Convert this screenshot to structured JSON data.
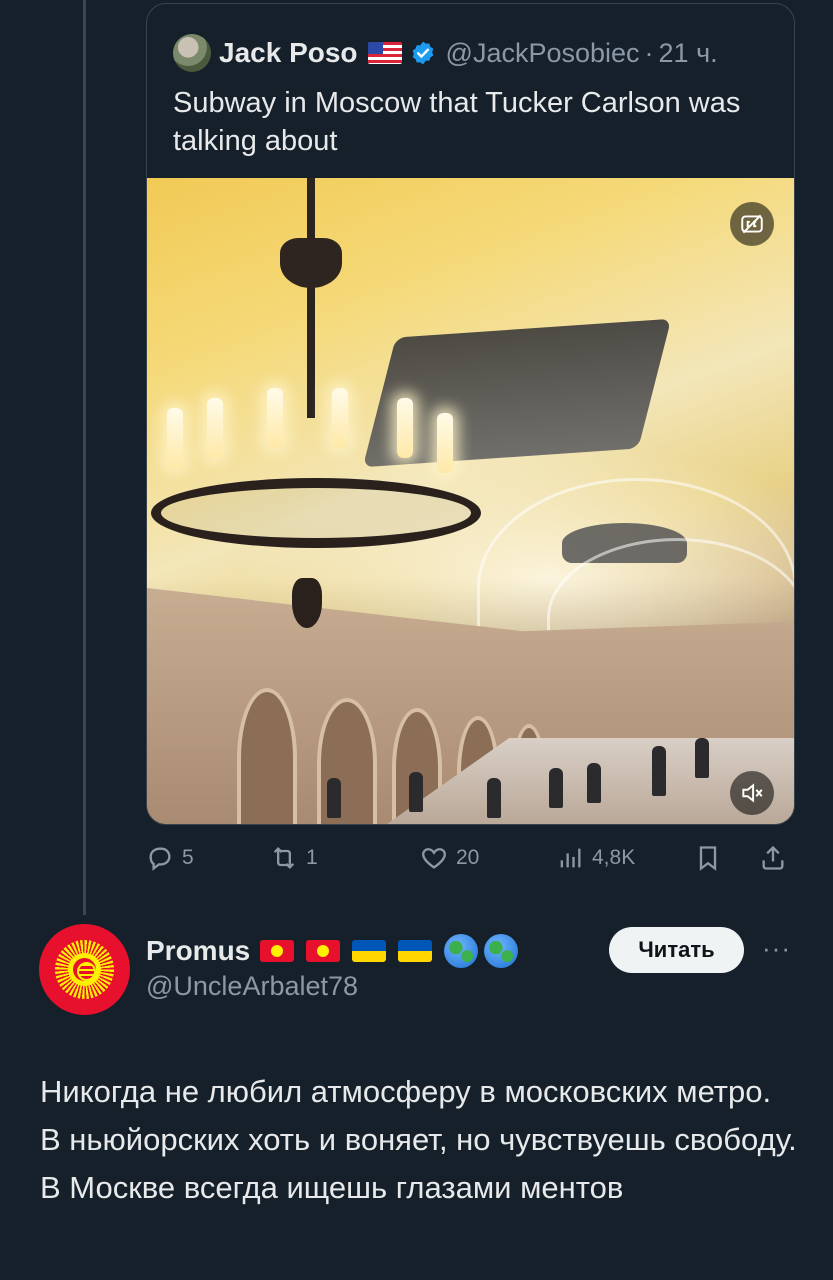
{
  "quoted_tweet": {
    "author_name": "Jack Poso",
    "handle": "@JackPosobiec",
    "separator": "·",
    "time": "21 ч.",
    "text": "Subway in Moscow that Tucker Carlson was talking about",
    "media": {
      "description": "Moscow metro station video",
      "cc_icon": "closed-captions-icon",
      "mute_icon": "volume-muted-icon"
    }
  },
  "actions": {
    "replies": "5",
    "reposts": "1",
    "likes": "20",
    "views": "4,8K"
  },
  "reply": {
    "author_name": "Promus",
    "handle": "@UncleArbalet78",
    "follow_label": "Читать",
    "more_label": "···",
    "text": "Никогда не любил атмосферу в московских метро. В ньюйорских хоть и воняет, но чувствуешь свободу. В Москве всегда ищешь глазами ментов"
  },
  "colors": {
    "background": "#15202b",
    "text_primary": "#e7e9ea",
    "text_secondary": "#8b98a5",
    "verified": "#1d9bf0"
  }
}
